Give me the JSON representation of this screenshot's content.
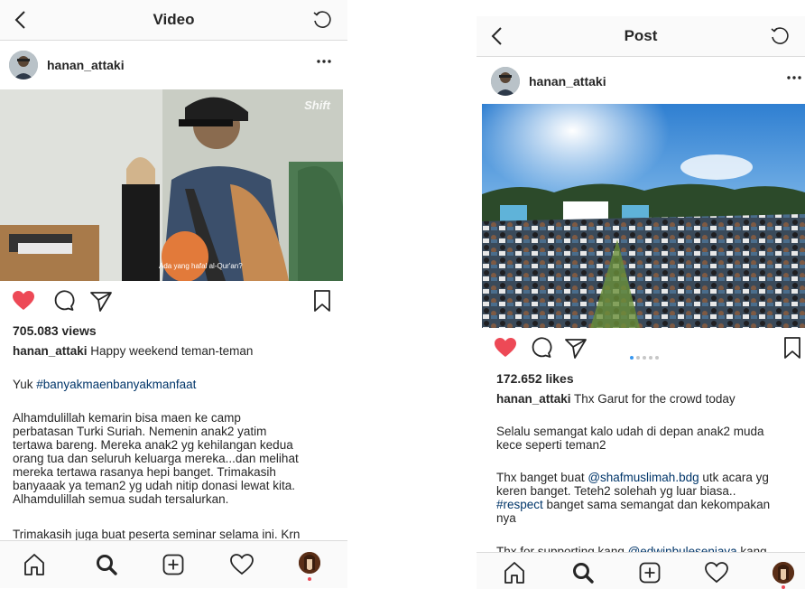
{
  "left": {
    "nav": {
      "title": "Video"
    },
    "post": {
      "username": "hanan_attaki",
      "views": "705.083 views",
      "caption_user": "hanan_attaki",
      "caption_text": "Happy weekend teman-teman",
      "p1_text": "Yuk ",
      "p1_tag": "#banyakmaenbanyakmanfaat",
      "p2_lines": [
        "Alhamdulillah kemarin bisa maen ke camp",
        "perbatasan Turki Suriah. Nemenin anak2 yatim",
        "tertawa bareng. Mereka anak2 yg kehilangan kedua",
        "orang tua dan seluruh keluarga mereka...dan melihat",
        "mereka tertawa rasanya hepi banget. Trimakasih",
        "banyaaak ya teman2 yg udah nitip donasi lewat kita.",
        "Alhamdulillah semua sudah tersalurkan."
      ],
      "p3_line": "Trimakasih juga buat peserta seminar selama ini. Krn",
      "video_subtitle": "Ada yang hafal al-Qur'an?",
      "video_watermark": "Shift",
      "liked": true
    }
  },
  "right": {
    "nav": {
      "title": "Post"
    },
    "post": {
      "username": "hanan_attaki",
      "likes": "172.652 likes",
      "caption_user": "hanan_attaki",
      "caption_text": "Thx Garut for the crowd today",
      "p1_lines": [
        "Selalu semangat kalo udah di depan anak2 muda",
        "kece seperti teman2"
      ],
      "p2_pre": "Thx banget buat ",
      "p2_mention": "@shafmuslimah.bdg",
      "p2_post": " utk acara yg",
      "p2_line2": "keren banget. Teteh2 solehah yg luar biasa..",
      "p2_tag": "#respect",
      "p2_line3_post": " banget sama semangat dan kekompakan",
      "p2_line4": "nya",
      "p3_pre": "Thx for supporting kang ",
      "p3_mention": "@edwinbuleseniava",
      "p3_post": " kang",
      "carousel": {
        "count": 5,
        "active": 0
      },
      "liked": true
    }
  },
  "colors": {
    "like_red": "#ed4956",
    "link_blue": "#003569",
    "carousel_active": "#3897f0",
    "bar_bg": "#fafafa",
    "divider": "#dbdbdb"
  },
  "icons": [
    "back-icon",
    "refresh-icon",
    "more-icon",
    "heart-icon",
    "comment-icon",
    "share-icon",
    "bookmark-icon",
    "home-icon",
    "search-icon",
    "add-icon",
    "activity-icon"
  ]
}
